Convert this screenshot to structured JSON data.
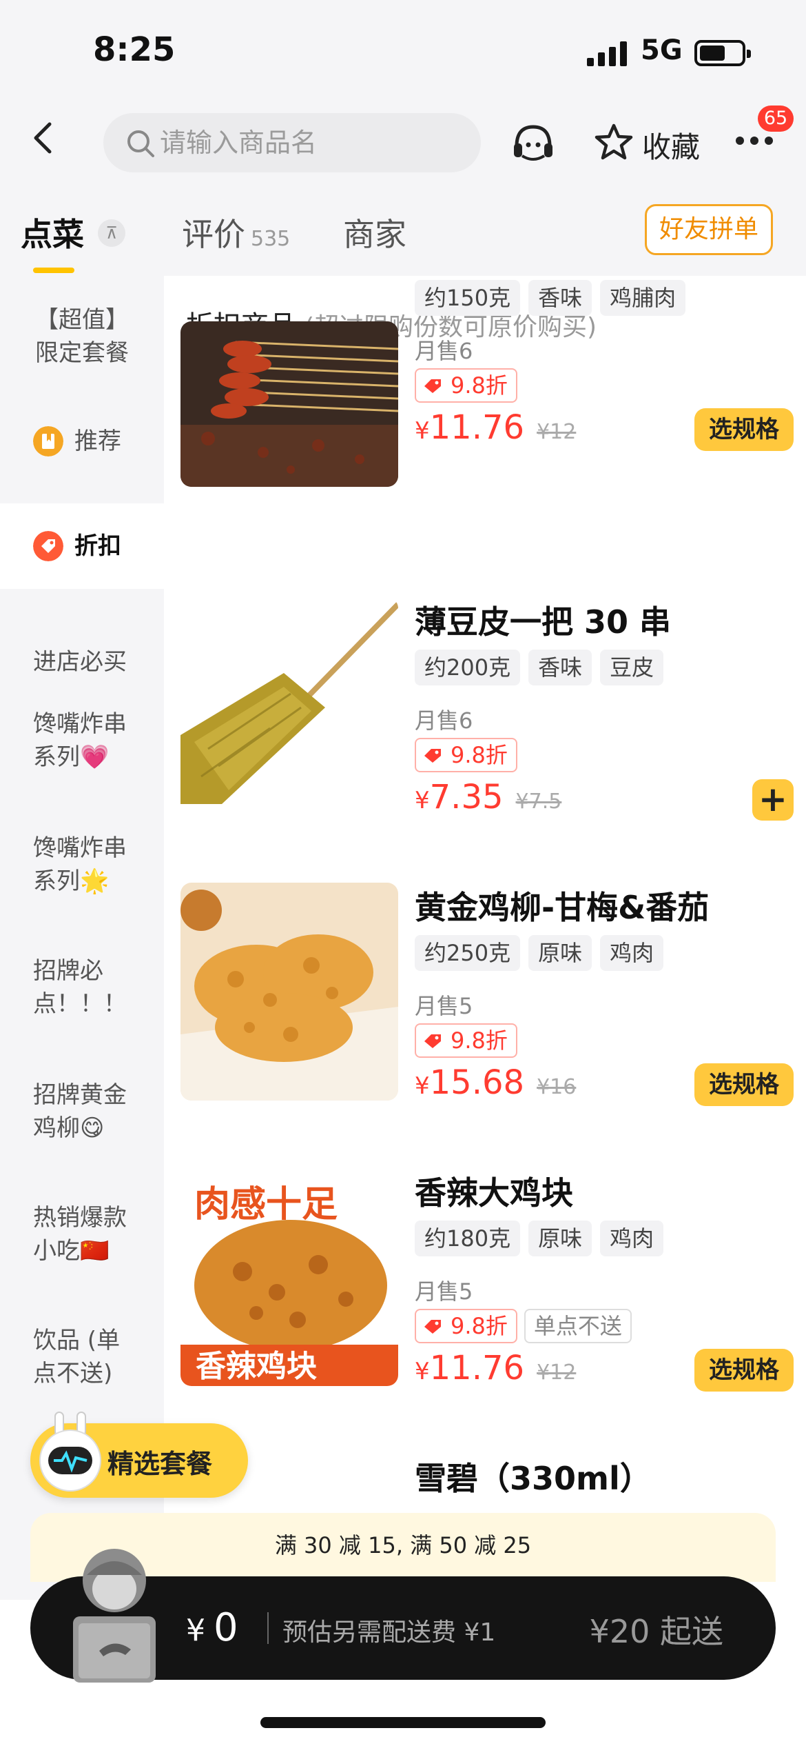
{
  "status_bar": {
    "time": "8:25",
    "network": "5G"
  },
  "nav": {
    "search_placeholder": "请输入商品名",
    "favorite_label": "收藏",
    "badge_count": "65"
  },
  "tabs": [
    {
      "label": "点菜",
      "count": ""
    },
    {
      "label": "评价",
      "count": "535"
    },
    {
      "label": "商家",
      "count": ""
    }
  ],
  "friend_order_label": "好友拼单",
  "sidebar": {
    "items": [
      {
        "label": "【超值】限定套餐"
      },
      {
        "label": "推荐"
      },
      {
        "label": "折扣"
      },
      {
        "label": "进店必买"
      },
      {
        "label": "馋嘴炸串系列💗"
      },
      {
        "label": "馋嘴炸串系列🌟"
      },
      {
        "label": "招牌必点！！！"
      },
      {
        "label": "招牌黄金鸡柳😋"
      },
      {
        "label": "热销爆款小吃🇨🇳"
      },
      {
        "label": "饮品 (单点不送)"
      }
    ]
  },
  "section": {
    "title": "折扣商品",
    "subtitle": "(超过限购份数可原价购买)"
  },
  "products": [
    {
      "name": "",
      "tags": [
        "约150克",
        "香味",
        "鸡脯肉"
      ],
      "sold": "月售6",
      "discount": "9.8折",
      "extra_tag": "",
      "currency": "¥",
      "price": "11.76",
      "original_price": "¥12",
      "action": "选规格"
    },
    {
      "name": "薄豆皮一把 30 串",
      "tags": [
        "约200克",
        "香味",
        "豆皮"
      ],
      "sold": "月售6",
      "discount": "9.8折",
      "extra_tag": "",
      "currency": "¥",
      "price": "7.35",
      "original_price": "¥7.5",
      "action": "+"
    },
    {
      "name": "黄金鸡柳-甘梅&番茄",
      "tags": [
        "约250克",
        "原味",
        "鸡肉"
      ],
      "sold": "月售5",
      "discount": "9.8折",
      "extra_tag": "",
      "currency": "¥",
      "price": "15.68",
      "original_price": "¥16",
      "action": "选规格"
    },
    {
      "name": "香辣大鸡块",
      "tags": [
        "约180克",
        "原味",
        "鸡肉"
      ],
      "sold": "月售5",
      "discount": "9.8折",
      "extra_tag": "单点不送",
      "currency": "¥",
      "price": "11.76",
      "original_price": "¥12",
      "action": "选规格"
    },
    {
      "name": "雪碧（330ml）",
      "tags": [],
      "sold": "",
      "discount": "",
      "extra_tag": "",
      "currency": "",
      "price": "",
      "original_price": "",
      "action": ""
    }
  ],
  "image_text": {
    "p4_top": "肉感十足",
    "p4_bottom": "香辣鸡块"
  },
  "promo": {
    "label": "精选套餐"
  },
  "offer_bar": {
    "text": "满 30 减 15, 满 50 减 25"
  },
  "cart": {
    "currency": "¥",
    "amount": "0",
    "delivery_fee": "预估另需配送费 ¥1",
    "min_order": "¥20 起送"
  }
}
